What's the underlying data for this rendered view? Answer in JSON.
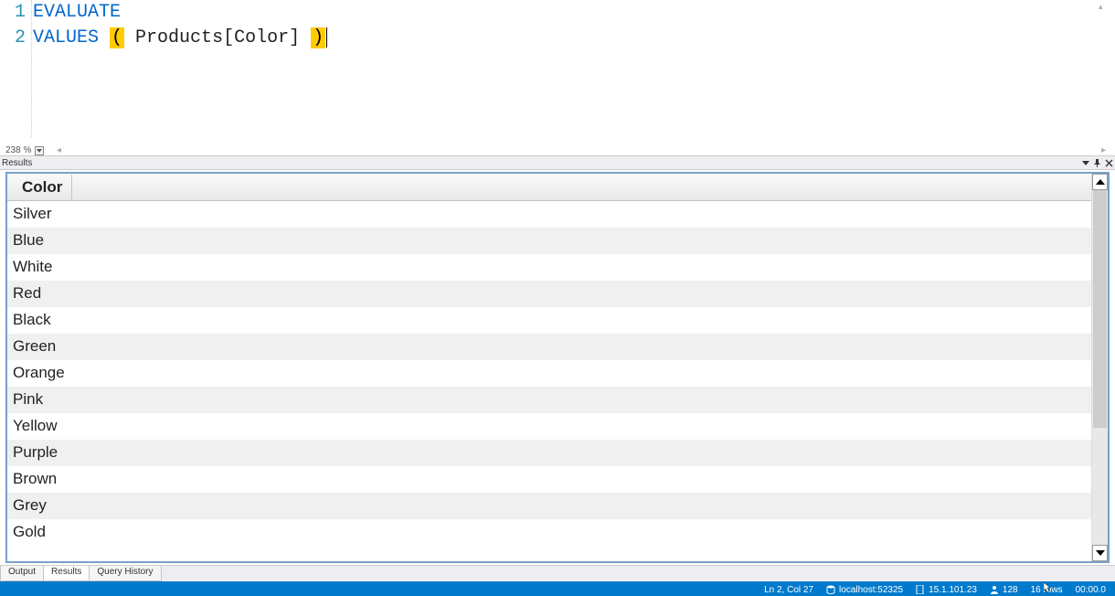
{
  "editor": {
    "lines": [
      {
        "n": "1",
        "tokens": [
          {
            "t": "EVALUATE",
            "c": "kw"
          }
        ]
      },
      {
        "n": "2",
        "tokens": [
          {
            "t": "VALUES",
            "c": "kw"
          },
          {
            "t": " ",
            "c": ""
          },
          {
            "t": "(",
            "c": "br"
          },
          {
            "t": " Products[Color] ",
            "c": "id"
          },
          {
            "t": ")",
            "c": "br"
          }
        ]
      }
    ],
    "zoom": "238 %"
  },
  "results": {
    "panel_label": "Results",
    "column": "Color",
    "rows": [
      "Silver",
      "Blue",
      "White",
      "Red",
      "Black",
      "Green",
      "Orange",
      "Pink",
      "Yellow",
      "Purple",
      "Brown",
      "Grey",
      "Gold"
    ]
  },
  "tabs": {
    "output": "Output",
    "results": "Results",
    "history": "Query History",
    "active": "results"
  },
  "status": {
    "pos": "Ln 2, Col 27",
    "server": "localhost:52325",
    "version": "15.1.101.23",
    "spid": "128",
    "rows": "16 rows",
    "time": "00:00.0"
  }
}
